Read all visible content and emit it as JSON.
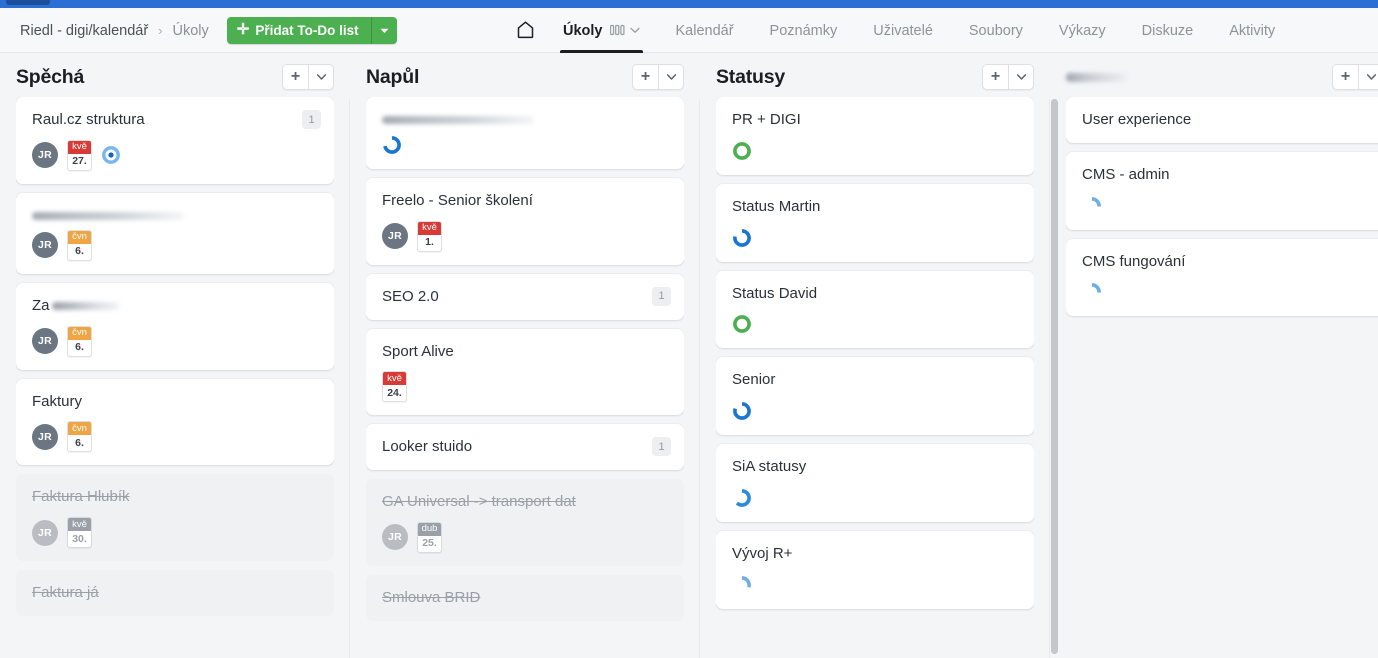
{
  "topbar": {
    "breadcrumb_root": "Riedl - digi/kalendář",
    "breadcrumb_separator": "›",
    "breadcrumb_current": "Úkoly",
    "add_button_label": "Přidat To-Do list",
    "add_button_plus": "✛",
    "accent_color": "#4caf50",
    "strip_color": "#2b6fd4"
  },
  "nav": {
    "home_icon": "home-icon",
    "items": [
      {
        "label": "Úkoly",
        "active": true,
        "has_view_icon": true,
        "has_caret": true
      },
      {
        "label": "Kalendář",
        "active": false
      },
      {
        "label": "Poznámky",
        "active": false
      },
      {
        "label": "Uživatelé",
        "active": false
      },
      {
        "label": "Soubory",
        "active": false
      },
      {
        "label": "Výkazy",
        "active": false
      },
      {
        "label": "Diskuze",
        "active": false
      },
      {
        "label": "Aktivity",
        "active": false
      }
    ]
  },
  "board": {
    "column_actions": {
      "add_label": "+",
      "menu_label": "▾"
    },
    "columns": [
      {
        "title": "Spěchá",
        "redacted_title": false,
        "has_scrollbar": false,
        "cards": [
          {
            "title": "Raul.cz struktura",
            "redacted": false,
            "done": false,
            "count": "1",
            "avatar": "JR",
            "date": {
              "month": "kvě",
              "day": "27.",
              "color": "red"
            },
            "icon": "dot-circle-icon"
          },
          {
            "title": "",
            "redacted": true,
            "done": false,
            "count": null,
            "avatar": "JR",
            "date": {
              "month": "čvn",
              "day": "6.",
              "color": "orange"
            }
          },
          {
            "title": "Za",
            "redacted": "partial",
            "done": false,
            "count": null,
            "avatar": "JR",
            "date": {
              "month": "čvn",
              "day": "6.",
              "color": "orange"
            }
          },
          {
            "title": "Faktury",
            "redacted": false,
            "done": false,
            "count": null,
            "avatar": "JR",
            "date": {
              "month": "čvn",
              "day": "6.",
              "color": "orange"
            }
          },
          {
            "title": "Faktura Hlubík",
            "redacted": false,
            "done": true,
            "count": null,
            "avatar": "JR",
            "date": {
              "month": "kvě",
              "day": "30.",
              "color": "grey"
            }
          },
          {
            "title": "Faktura já",
            "redacted": false,
            "done": true,
            "count": null,
            "avatar": null,
            "date": null
          }
        ]
      },
      {
        "title": "Napůl",
        "redacted_title": false,
        "has_scrollbar": false,
        "cards": [
          {
            "title": "",
            "redacted": true,
            "done": false,
            "count": null,
            "ring": {
              "percent": 72,
              "color": "#1976d2"
            }
          },
          {
            "title": "Freelo - Senior školení",
            "redacted": false,
            "done": false,
            "count": null,
            "avatar": "JR",
            "date": {
              "month": "kvě",
              "day": "1.",
              "color": "red"
            }
          },
          {
            "title": "SEO 2.0",
            "redacted": false,
            "done": false,
            "count": "1"
          },
          {
            "title": "Sport Alive",
            "redacted": false,
            "done": false,
            "count": null,
            "date": {
              "month": "kvě",
              "day": "24.",
              "color": "red"
            }
          },
          {
            "title": "Looker stuido",
            "redacted": false,
            "done": false,
            "count": "1"
          },
          {
            "title": "GA Universal -> transport dat",
            "redacted": false,
            "done": true,
            "count": null,
            "avatar": "JR",
            "date": {
              "month": "dub",
              "day": "25.",
              "color": "grey"
            }
          },
          {
            "title": "Smlouva BRID",
            "redacted": false,
            "done": true,
            "count": null
          }
        ]
      },
      {
        "title": "Statusy",
        "redacted_title": false,
        "has_scrollbar": true,
        "cards": [
          {
            "title": "PR + DIGI",
            "redacted": false,
            "done": false,
            "ring": {
              "percent": 100,
              "color": "#4caf50"
            }
          },
          {
            "title": "Status Martin",
            "redacted": false,
            "done": false,
            "ring": {
              "percent": 78,
              "color": "#1976d2"
            }
          },
          {
            "title": "Status David",
            "redacted": false,
            "done": false,
            "ring": {
              "percent": 100,
              "color": "#4caf50"
            }
          },
          {
            "title": "Senior",
            "redacted": false,
            "done": false,
            "ring": {
              "percent": 80,
              "color": "#1976d2"
            }
          },
          {
            "title": "SiA statusy",
            "redacted": false,
            "done": false,
            "ring": {
              "percent": 62,
              "color": "#2a8bdf"
            }
          },
          {
            "title": "Vývoj R+",
            "redacted": false,
            "done": false,
            "ring": {
              "percent": 30,
              "color": "#6eaee8"
            }
          }
        ]
      },
      {
        "title": "",
        "redacted_title": true,
        "has_scrollbar": false,
        "cards": [
          {
            "title": "User experience",
            "redacted": false,
            "done": false
          },
          {
            "title": "CMS - admin",
            "redacted": false,
            "done": false,
            "ring": {
              "percent": 26,
              "color": "#6eaee8"
            }
          },
          {
            "title": "CMS fungování",
            "redacted": false,
            "done": false,
            "ring": {
              "percent": 26,
              "color": "#6eaee8"
            }
          }
        ]
      }
    ]
  }
}
